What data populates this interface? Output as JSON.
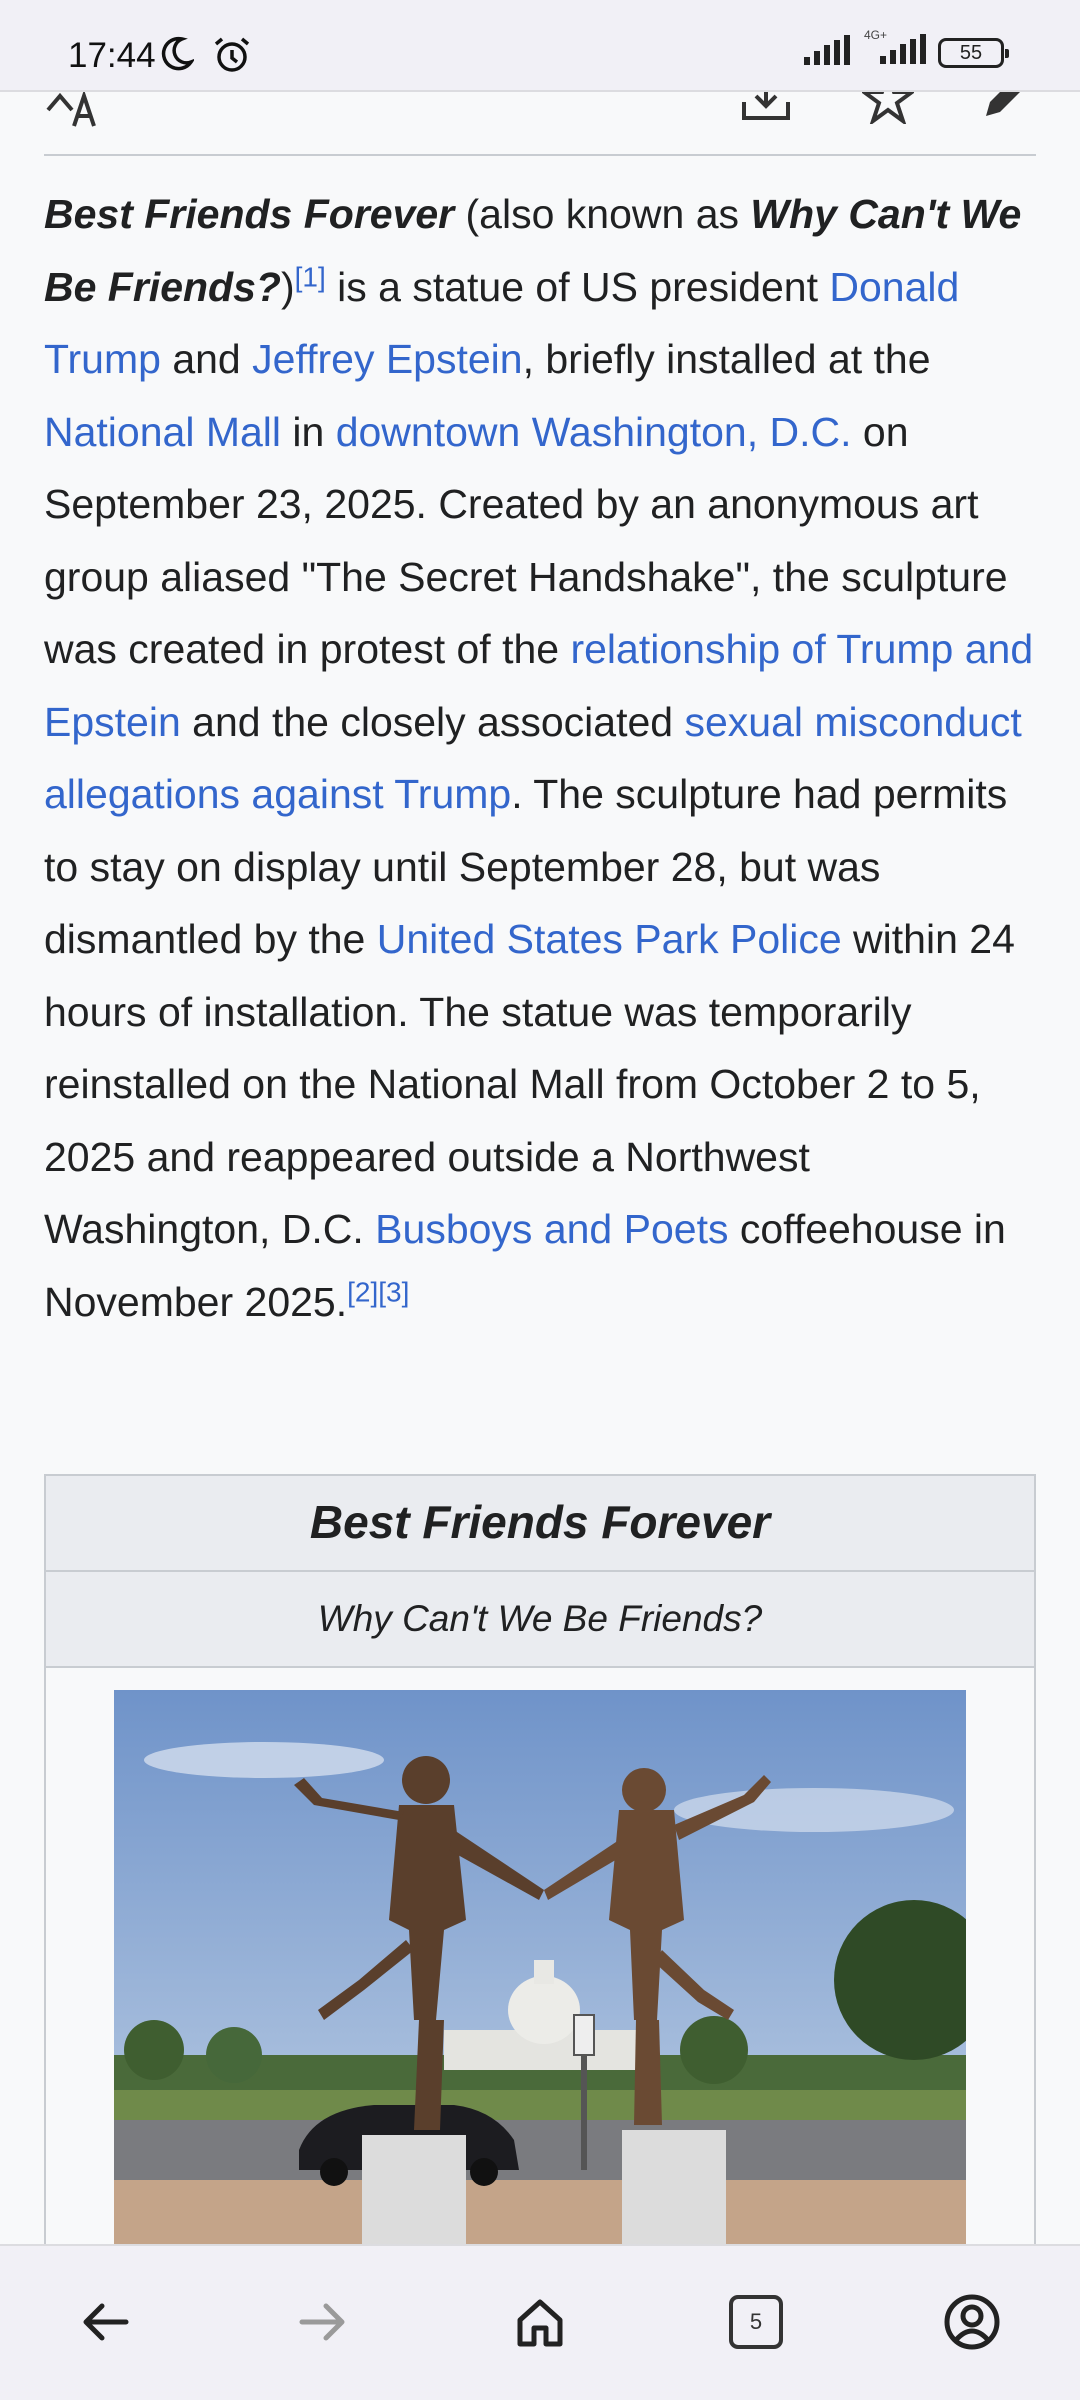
{
  "status_bar": {
    "time": "17:44",
    "network_label": "4G+",
    "battery": "55"
  },
  "toolbar": {
    "text_size_glyph": "A"
  },
  "article": {
    "p1": "Best Friends Forever",
    "p2": " (also known as ",
    "p3": "Why Can't We Be Friends?",
    "p4": ")",
    "ref1": "[1]",
    "p5": " is a statue of US president ",
    "link_trump": "Donald Trump",
    "p6": " and ",
    "link_epstein": "Jeffrey Epstein",
    "p7": ", briefly installed at the ",
    "link_mall": "National Mall",
    "p8": " in ",
    "link_dc": "downtown Washington, D.C.",
    "p9": " on September 23, 2025. Created by an anonymous art group aliased \"The Secret Handshake\", the sculpture was created in protest of the ",
    "link_relationship": "relationship of Trump and Epstein",
    "p10": " and the closely associated ",
    "link_allegations": "sexual misconduct allegations against Trump",
    "p11": ". The sculpture had permits to stay on display until September 28, but was dismantled by the ",
    "link_police": "United States Park Police",
    "p12": " within 24 hours of installation. The statue was temporarily reinstalled on the National Mall from October 2 to 5, 2025 and reappeared outside a Northwest Washington, D.C. ",
    "link_busboys": "Busboys and Poets",
    "p13": " coffeehouse in November 2025.",
    "ref2": "[2]",
    "ref3": "[3]"
  },
  "infobox": {
    "title": "Best Friends Forever",
    "subtitle": "Why Can't We Be Friends?"
  },
  "bottom_nav": {
    "tab_count": "5",
    "icons": [
      "back-arrow-icon",
      "forward-arrow-icon",
      "home-icon",
      "tabs-icon",
      "account-icon"
    ]
  },
  "colors": {
    "link": "#3366cc",
    "text": "#202122",
    "background": "#f8f9fa"
  }
}
